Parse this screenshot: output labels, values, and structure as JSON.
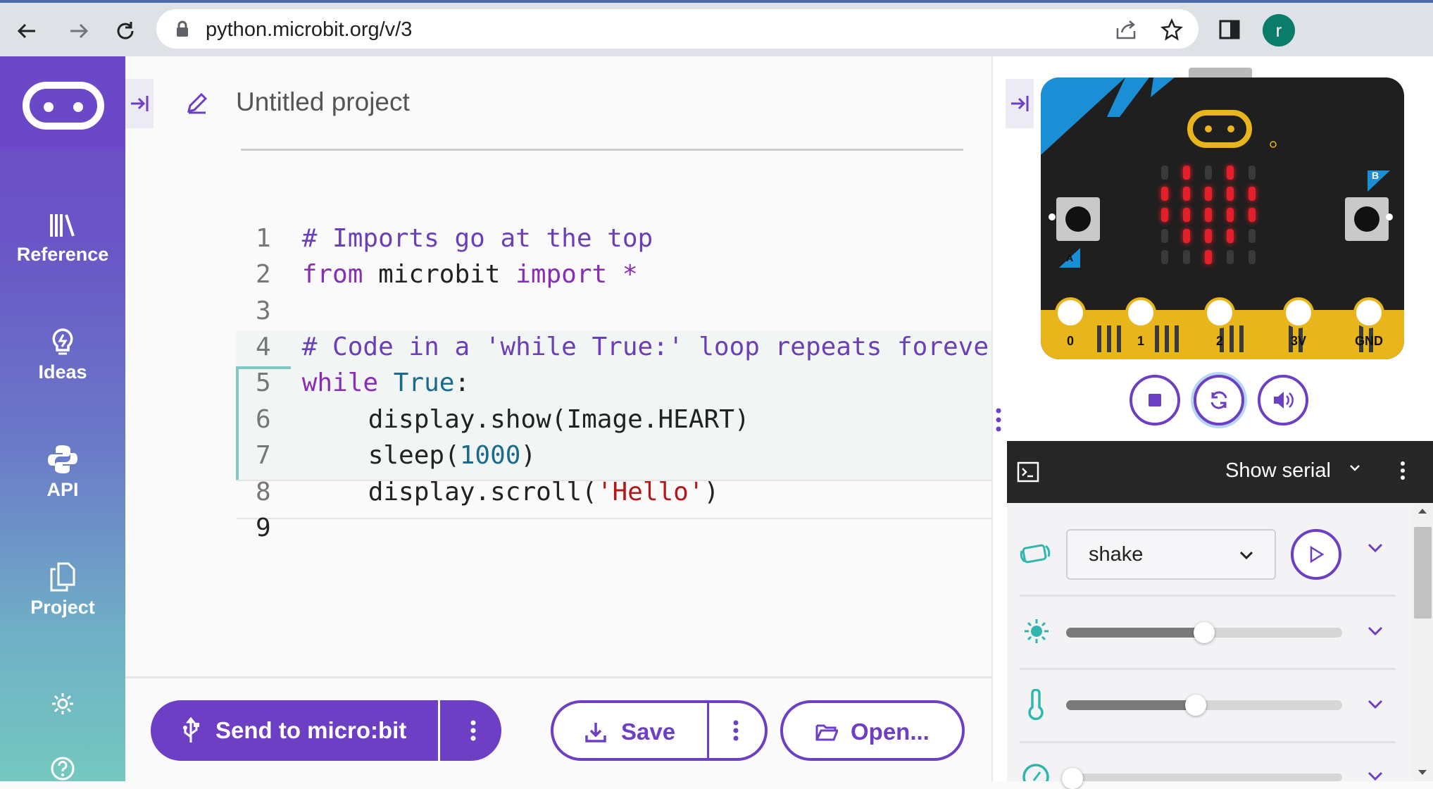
{
  "browser": {
    "url": "python.microbit.org/v/3",
    "avatar_letter": "r"
  },
  "sidebar": {
    "items": [
      {
        "label": "Reference",
        "icon": "library-icon"
      },
      {
        "label": "Ideas",
        "icon": "lightbulb-icon"
      },
      {
        "label": "API",
        "icon": "python-icon"
      },
      {
        "label": "Project",
        "icon": "files-icon"
      }
    ]
  },
  "editor": {
    "project_name": "Untitled project",
    "lines": [
      {
        "n": "1"
      },
      {
        "n": "2"
      },
      {
        "n": "3"
      },
      {
        "n": "4"
      },
      {
        "n": "5"
      },
      {
        "n": "6"
      },
      {
        "n": "7"
      },
      {
        "n": "8"
      },
      {
        "n": "9"
      }
    ],
    "code": {
      "l1": "# Imports go at the top",
      "l2_from": "from",
      "l2_mod": " microbit ",
      "l2_import": "import",
      "l2_star": " *",
      "l4": "# Code in a 'while True:' loop repeats forever",
      "l5_while": "while",
      "l5_true": " True",
      "l5_colon": ":",
      "l6": "display.show(Image.HEART)",
      "l7_a": "sleep(",
      "l7_num": "1000",
      "l7_b": ")",
      "l8_a": "display.scroll(",
      "l8_str": "'Hello'",
      "l8_b": ")"
    }
  },
  "toolbar": {
    "send_label": "Send to micro:bit",
    "save_label": "Save",
    "open_label": "Open..."
  },
  "simulator": {
    "pins": [
      "0",
      "1",
      "2",
      "3V",
      "GND"
    ],
    "button_a": "A",
    "button_b": "B",
    "serial_label": "Show serial",
    "gesture_value": "shake",
    "light_level": 0.5,
    "temperature_level": 0.47,
    "colors": {
      "accent": "#6c3fc4",
      "led_on": "#e3202a",
      "edge_gold": "#e8b51c",
      "teal_icon": "#2fb7ae"
    }
  }
}
